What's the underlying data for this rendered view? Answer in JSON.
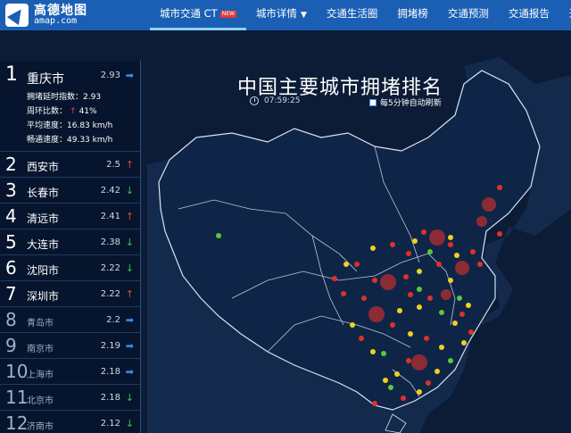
{
  "header": {
    "logo": {
      "name": "高德地图",
      "url": "amap.com"
    },
    "nav": [
      {
        "label": "城市交通 CT",
        "new_tag": "NEW",
        "active": true
      },
      {
        "label": "城市详情",
        "caret": "▼"
      },
      {
        "label": "交通生活圈"
      },
      {
        "label": "拥堵榜"
      },
      {
        "label": "交通预测"
      },
      {
        "label": "交通报告"
      },
      {
        "label": "迁徙"
      }
    ]
  },
  "map": {
    "title": "中国主要城市拥堵排名",
    "time": "07:59:25",
    "refresh_label": "每5分钟自动刷新",
    "colors": {
      "red": "#e0302a",
      "yellow": "#f0d020",
      "green": "#5ac83a"
    }
  },
  "ranking": [
    {
      "rank": "1",
      "city": "重庆市",
      "value": "2.93",
      "trend": "flat",
      "details": [
        {
          "label": "拥堵延时指数：",
          "value": "2.93"
        },
        {
          "label": "周环比数：",
          "value": "41%",
          "trend": "up"
        },
        {
          "label": "平均速度：",
          "value": "16.83 km/h"
        },
        {
          "label": "畅通速度：",
          "value": "49.33 km/h"
        }
      ]
    },
    {
      "rank": "2",
      "city": "西安市",
      "value": "2.5",
      "trend": "up"
    },
    {
      "rank": "3",
      "city": "长春市",
      "value": "2.42",
      "trend": "down"
    },
    {
      "rank": "4",
      "city": "清远市",
      "value": "2.41",
      "trend": "up"
    },
    {
      "rank": "5",
      "city": "大连市",
      "value": "2.38",
      "trend": "down"
    },
    {
      "rank": "6",
      "city": "沈阳市",
      "value": "2.22",
      "trend": "down"
    },
    {
      "rank": "7",
      "city": "深圳市",
      "value": "2.22",
      "trend": "up"
    },
    {
      "rank": "8",
      "city": "青岛市",
      "value": "2.2",
      "trend": "flat"
    },
    {
      "rank": "9",
      "city": "南京市",
      "value": "2.19",
      "trend": "flat"
    },
    {
      "rank": "10",
      "city": "上海市",
      "value": "2.18",
      "trend": "flat"
    },
    {
      "rank": "11",
      "city": "北京市",
      "value": "2.18",
      "trend": "down"
    },
    {
      "rank": "12",
      "city": "济南市",
      "value": "2.12",
      "trend": "down"
    }
  ]
}
